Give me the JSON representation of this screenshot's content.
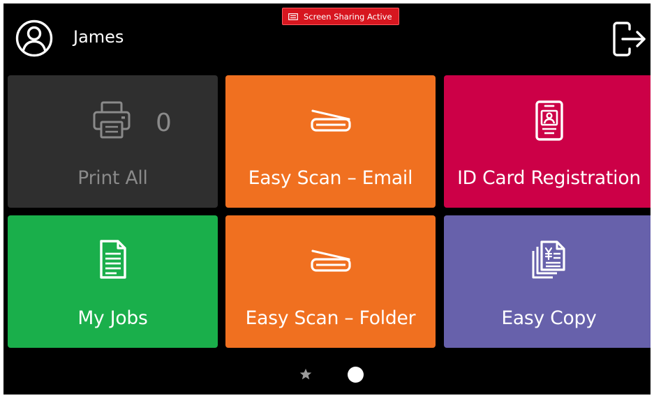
{
  "header": {
    "user_name": "James",
    "screen_sharing_label": "Screen Sharing Active",
    "avatar_icon": "user-circle-icon",
    "logout_icon": "logout-icon",
    "screen_sharing_icon": "screen-share-icon"
  },
  "tiles": [
    {
      "label": "Print All",
      "count": "0",
      "icon": "printer-icon",
      "color": "#2f2f2f"
    },
    {
      "label": "Easy Scan – Email",
      "icon": "scanner-icon",
      "color": "#f07020"
    },
    {
      "label": "ID Card Registration",
      "icon": "id-card-icon",
      "color": "#cc0047"
    },
    {
      "label": "My Jobs",
      "icon": "document-icon",
      "color": "#1aaf4b"
    },
    {
      "label": "Easy Scan – Folder",
      "icon": "scanner-icon",
      "color": "#f07020"
    },
    {
      "label": "Easy Copy",
      "icon": "copy-icon",
      "color": "#6761ab"
    }
  ],
  "pager": {
    "pages": [
      "favorites",
      "page-1"
    ],
    "active_page": 1,
    "favorites_icon": "star-icon"
  },
  "colors": {
    "background": "#000000",
    "text": "#ffffff",
    "disabled_text": "#8a8a8a",
    "badge": "#d7161f"
  }
}
